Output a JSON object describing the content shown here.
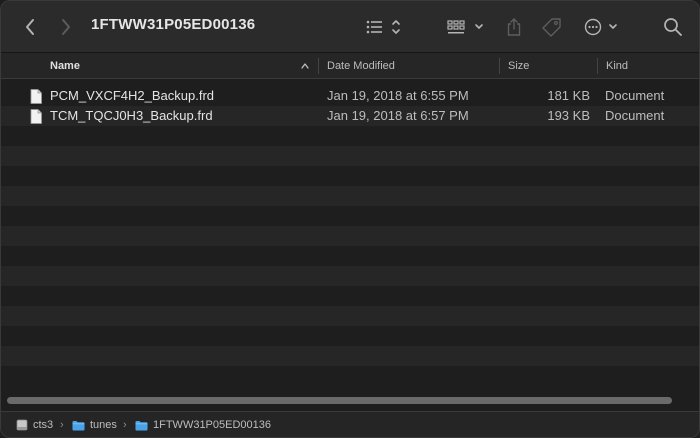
{
  "window": {
    "title": "1FTWW31P05ED00136"
  },
  "toolbar": {
    "back_icon": "chevron-left-icon",
    "forward_icon": "chevron-right-icon",
    "view_icon": "list-view-icon",
    "group_icon": "grid-group-icon",
    "share_icon": "share-icon",
    "tag_icon": "tag-icon",
    "action_icon": "ellipsis-circle-icon",
    "search_icon": "search-icon"
  },
  "columns": {
    "name": "Name",
    "date": "Date Modified",
    "size": "Size",
    "kind": "Kind"
  },
  "files": [
    {
      "name": "PCM_VXCF4H2_Backup.frd",
      "date": "Jan 19, 2018 at 6:55 PM",
      "size": "181 KB",
      "kind": "Document"
    },
    {
      "name": "TCM_TQCJ0H3_Backup.frd",
      "date": "Jan 19, 2018 at 6:57 PM",
      "size": "193 KB",
      "kind": "Document"
    }
  ],
  "pathbar": [
    {
      "label": "cts3",
      "icon": "drive-icon"
    },
    {
      "label": "tunes",
      "icon": "folder-icon"
    },
    {
      "label": "1FTWW31P05ED00136",
      "icon": "folder-icon"
    }
  ],
  "colors": {
    "folder": "#4aa3e8",
    "background": "#1e1e1e",
    "stripe": "#262626"
  }
}
